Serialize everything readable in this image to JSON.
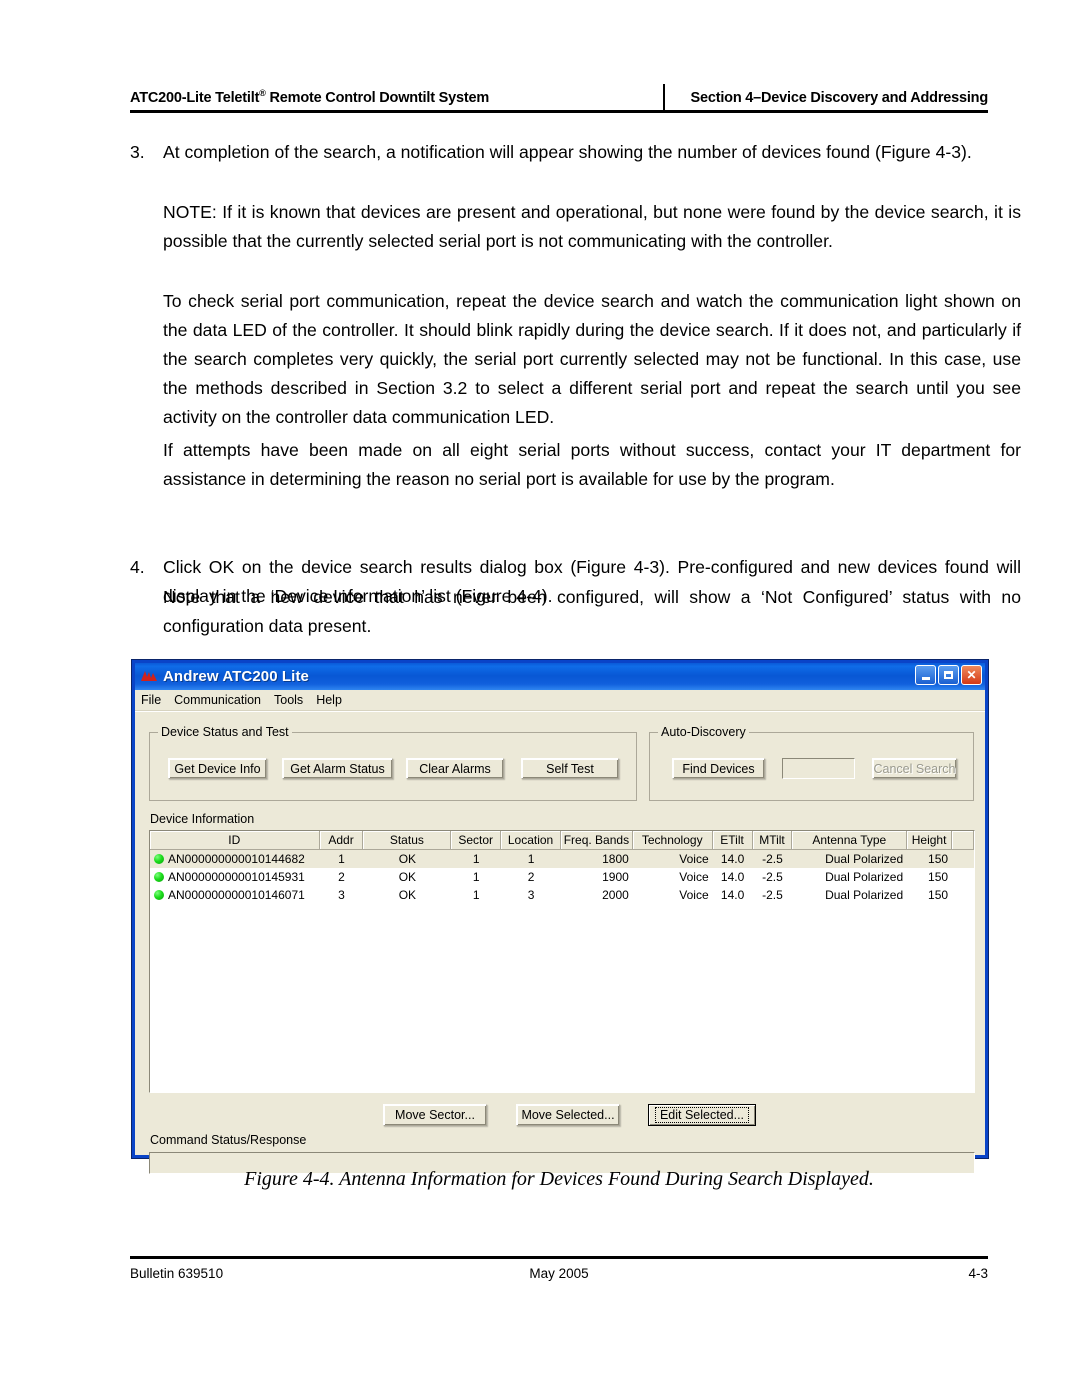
{
  "header": {
    "left_title": "ATC200-Lite Teletilt",
    "left_title_sup": "®",
    "left_title_rest": " Remote Control Downtilt System",
    "right_title": "Section 4–Device Discovery and Addressing"
  },
  "body": {
    "item3_num": "3.",
    "item3_text": "At completion of the search, a notification will appear showing the number of devices found (Figure 4-3).",
    "note_text": "NOTE: If it is known that devices are present and operational, but none were found by the device search, it is possible that the currently selected serial port is not communicating with the controller.",
    "para_serial": "To check serial port communication, repeat the device search and watch the communication light shown on the data LED of the controller. It should blink rapidly during the device search. If it does not, and particularly if the search completes very quickly, the serial port currently selected may not be functional. In this case, use the methods described in Section 3.2 to select a different serial port and repeat the search until you see activity on the controller data communication LED.",
    "para_attempts": "If attempts have been made on all eight serial ports without success, contact your IT department for assistance in determining the reason no serial port is available for use by the program.",
    "item4_num": "4.",
    "item4_text": "Click OK on the device search results dialog box (Figure 4-3). Pre-configured and new devices found will display in the ‘Device Information’ list (Figure 4-4).",
    "para_notconfigured": "Note that a new device that has never been configured, will show a ‘Not Configured’ status with no configuration data present."
  },
  "app": {
    "title": "Andrew ATC200 Lite",
    "menu": [
      "File",
      "Communication",
      "Tools",
      "Help"
    ],
    "titlebar_buttons": [
      "minimize",
      "maximize",
      "close"
    ],
    "colors": {
      "titlebar_blue": "#0a5ad8",
      "close_red": "#d43a16",
      "face": "#ece9d8",
      "led_green": "#1ddd1d"
    },
    "group_status": {
      "label": "Device Status and Test",
      "buttons": [
        "Get Device Info",
        "Get Alarm Status",
        "Clear Alarms",
        "Self Test"
      ]
    },
    "group_discovery": {
      "label": "Auto-Discovery",
      "find_button": "Find Devices",
      "progress_value": "",
      "cancel_button": "Cancel Search",
      "cancel_disabled": true
    },
    "device_information": {
      "label": "Device Information",
      "columns": [
        "ID",
        "Addr",
        "Status",
        "Sector",
        "Location",
        "Freq. Bands",
        "Technology",
        "ETilt",
        "MTilt",
        "Antenna Type",
        "Height",
        ""
      ],
      "rows": [
        {
          "led": "green",
          "selected": true,
          "cells": [
            "AN000000000010144682",
            "1",
            "OK",
            "1",
            "1",
            "1800",
            "Voice",
            "14.0",
            "-2.5",
            "Dual Polarized",
            "150",
            ""
          ]
        },
        {
          "led": "green",
          "selected": false,
          "cells": [
            "AN000000000010145931",
            "2",
            "OK",
            "1",
            "2",
            "1900",
            "Voice",
            "14.0",
            "-2.5",
            "Dual Polarized",
            "150",
            ""
          ]
        },
        {
          "led": "green",
          "selected": false,
          "cells": [
            "AN000000000010146071",
            "3",
            "OK",
            "1",
            "3",
            "2000",
            "Voice",
            "14.0",
            "-2.5",
            "Dual Polarized",
            "150",
            ""
          ]
        }
      ]
    },
    "action_buttons": [
      "Move Sector...",
      "Move Selected...",
      "Edit Selected..."
    ],
    "command_status": {
      "label": "Command Status/Response",
      "value": ""
    }
  },
  "caption": "Figure 4-4. Antenna Information for Devices Found During Search Displayed.",
  "footer": {
    "bulletin": "Bulletin 639510",
    "date": "May 2005",
    "page": "4-3"
  }
}
